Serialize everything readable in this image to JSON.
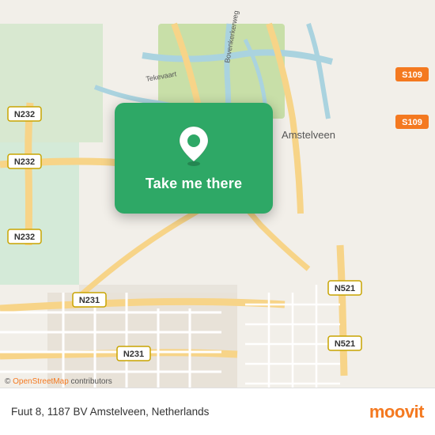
{
  "map": {
    "background_color": "#f2efe9",
    "center_lat": 52.29,
    "center_lon": 4.86
  },
  "overlay": {
    "button_label": "Take me there",
    "background_color": "#2ea866"
  },
  "bottom_bar": {
    "address": "Fuut 8, 1187 BV Amstelveen, Netherlands",
    "osm_credit": "© OpenStreetMap contributors",
    "logo_text_1": "moovi",
    "logo_text_2": "t"
  }
}
